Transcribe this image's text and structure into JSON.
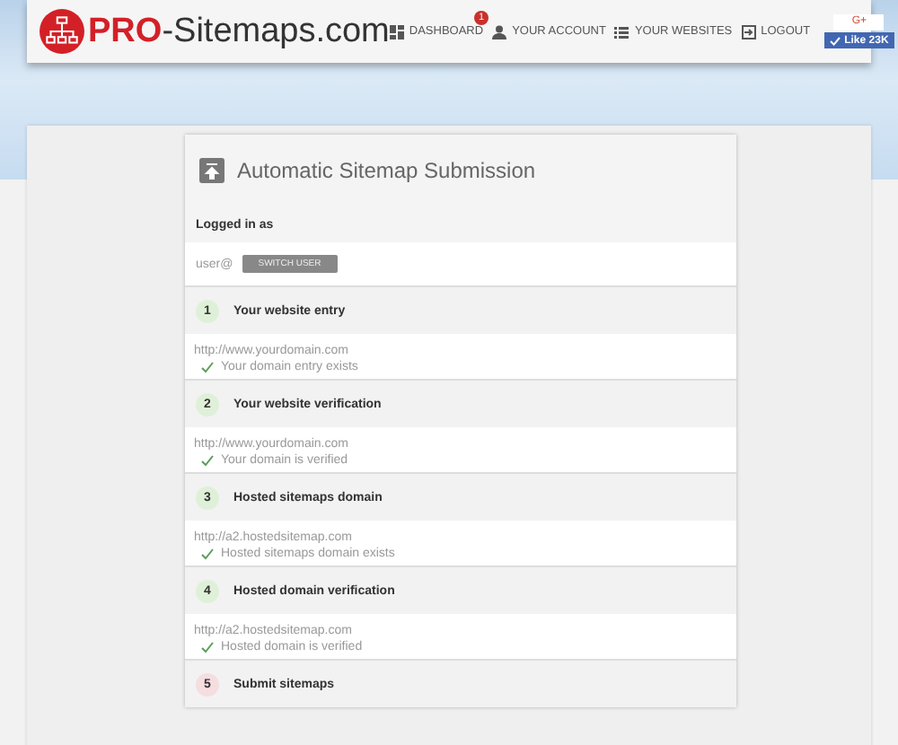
{
  "header": {
    "logo": {
      "brand": "PRO",
      "rest": "-Sitemaps.com"
    },
    "nav": [
      {
        "label": "DASHBOARD",
        "kind": "dashboard",
        "badge": "1"
      },
      {
        "label": "YOUR ACCOUNT",
        "kind": "account"
      },
      {
        "label": "YOUR WEBSITES",
        "kind": "websites"
      },
      {
        "label": "LOGOUT",
        "kind": "logout"
      }
    ],
    "social": {
      "gplus": "G+",
      "like": "Like 23K"
    }
  },
  "card": {
    "title": "Automatic Sitemap Submission",
    "login": {
      "heading": "Logged in as",
      "user": "user@",
      "button": "SWITCH USER"
    },
    "steps": [
      {
        "number": "1",
        "title": "Your website entry",
        "done": true,
        "url": "http://www.yourdomain.com",
        "status": "Your domain entry exists"
      },
      {
        "number": "2",
        "title": "Your website verification",
        "done": true,
        "url": "http://www.yourdomain.com",
        "status": "Your domain is verified"
      },
      {
        "number": "3",
        "title": "Hosted sitemaps domain",
        "done": true,
        "url": "http://a2.hostedsitemap.com",
        "status": "Hosted sitemaps domain exists"
      },
      {
        "number": "4",
        "title": "Hosted domain verification",
        "done": true,
        "url": "http://a2.hostedsitemap.com",
        "status": "Hosted domain is verified"
      },
      {
        "number": "5",
        "title": "Submit sitemaps",
        "done": false
      }
    ]
  }
}
